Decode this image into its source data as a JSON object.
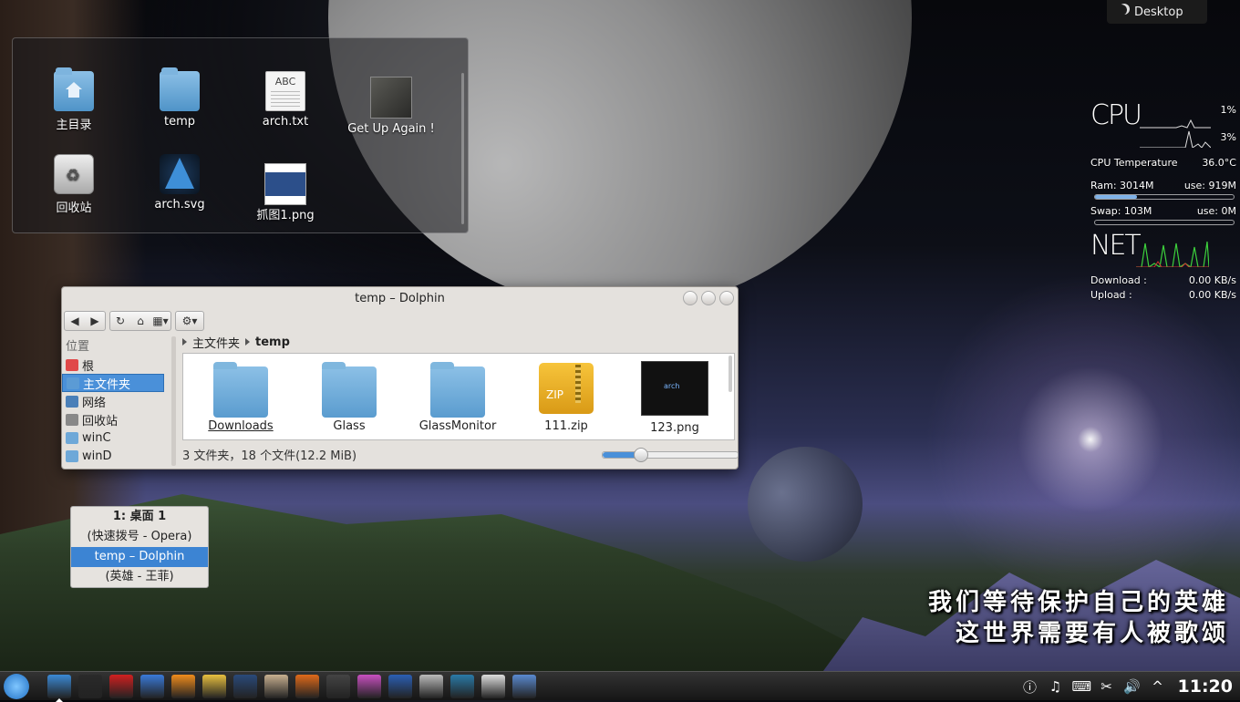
{
  "desktop_button": {
    "label": "Desktop"
  },
  "folder_view": {
    "items": [
      {
        "label": "主目录",
        "icon": "home-folder-icon"
      },
      {
        "label": "temp",
        "icon": "folder-icon"
      },
      {
        "label": "arch.txt",
        "icon": "text-file-icon",
        "icon_text": "ABC"
      },
      {
        "label": "Get Up Again !",
        "icon": "image-file-icon"
      },
      {
        "label": "回收站",
        "icon": "trash-icon"
      },
      {
        "label": "arch.svg",
        "icon": "arch-logo-icon"
      },
      {
        "label": "抓图1.png",
        "icon": "png-file-icon"
      }
    ]
  },
  "dolphin": {
    "title": "temp – Dolphin",
    "sidebar_header": "位置",
    "places": [
      {
        "label": "根",
        "color": "#e04848"
      },
      {
        "label": "主文件夹",
        "color": "#5b9bd5",
        "selected": true
      },
      {
        "label": "网络",
        "color": "#4a7fb8"
      },
      {
        "label": "回收站",
        "color": "#888888"
      },
      {
        "label": "winC",
        "color": "#6ea8d8"
      },
      {
        "label": "winD",
        "color": "#6ea8d8"
      }
    ],
    "breadcrumb": {
      "parent": "主文件夹",
      "current": "temp"
    },
    "files": [
      {
        "label": "Downloads",
        "type": "folder"
      },
      {
        "label": "Glass",
        "type": "folder"
      },
      {
        "label": "GlassMonitor",
        "type": "folder"
      },
      {
        "label": "111.zip",
        "type": "zip",
        "icon_text": "ZIP"
      },
      {
        "label": "123.png",
        "type": "image"
      }
    ],
    "status": "3 文件夹，18 个文件(12.2 MiB)",
    "zoom_level": 0.28
  },
  "task_switcher": {
    "header": "1: 桌面 1",
    "items": [
      {
        "label": "(快速拨号 - Opera)",
        "selected": false
      },
      {
        "label": "temp – Dolphin",
        "selected": true
      },
      {
        "label": "(英雄 - 王菲)",
        "selected": false
      }
    ]
  },
  "sysmon": {
    "cpu_label": "CPU",
    "cpu1": "1%",
    "cpu2": "3%",
    "temp_label": "CPU Temperature",
    "temp_value": "36.0°C",
    "ram_label": "Ram: 3014M",
    "ram_use": "use: 919M",
    "ram_fraction": 0.3,
    "swap_label": "Swap: 103M",
    "swap_use": "use: 0M",
    "swap_fraction": 0.0,
    "net_label": "NET",
    "download_label": "Download :",
    "download_value": "0.00 KB/s",
    "upload_label": "Upload :",
    "upload_value": "0.00 KB/s"
  },
  "lyrics": {
    "line1": "我们等待保护自己的英雄",
    "line2": "这世界需要有人被歌颂"
  },
  "taskbar": {
    "apps": [
      {
        "name": "dolphin-app-icon",
        "color": "#3b8ad6",
        "active": true
      },
      {
        "name": "terminal-app-icon",
        "color": "#2a2a2a"
      },
      {
        "name": "opera-app-icon",
        "color": "#d02020"
      },
      {
        "name": "compass-app-icon",
        "color": "#3a7ad8"
      },
      {
        "name": "burst-app-icon",
        "color": "#f08c1c"
      },
      {
        "name": "bluetooth-app-icon",
        "color": "#e8c040"
      },
      {
        "name": "video-app-icon",
        "color": "#2a4a7a"
      },
      {
        "name": "eye-app-icon",
        "color": "#c8b090"
      },
      {
        "name": "firefox-app-icon",
        "color": "#e06a1a"
      },
      {
        "name": "camera-app-icon",
        "color": "#444444"
      },
      {
        "name": "paint-app-icon",
        "color": "#c850c0"
      },
      {
        "name": "word-app-icon",
        "color": "#2b5fb4"
      },
      {
        "name": "calculator-app-icon",
        "color": "#bbbbbb"
      },
      {
        "name": "monitor-app-icon",
        "color": "#2a7aa8"
      },
      {
        "name": "notes-app-icon",
        "color": "#dddddd"
      },
      {
        "name": "tools-app-icon",
        "color": "#5a8ad0"
      }
    ],
    "tray_icons": [
      "info-icon",
      "music-note-icon",
      "keyboard-icon",
      "scissors-icon",
      "volume-icon",
      "expand-up-icon"
    ],
    "tray_glyphs": [
      "ⓘ",
      "♫",
      "⌨",
      "✂",
      "🔊",
      "^"
    ],
    "clock": "11:20"
  }
}
